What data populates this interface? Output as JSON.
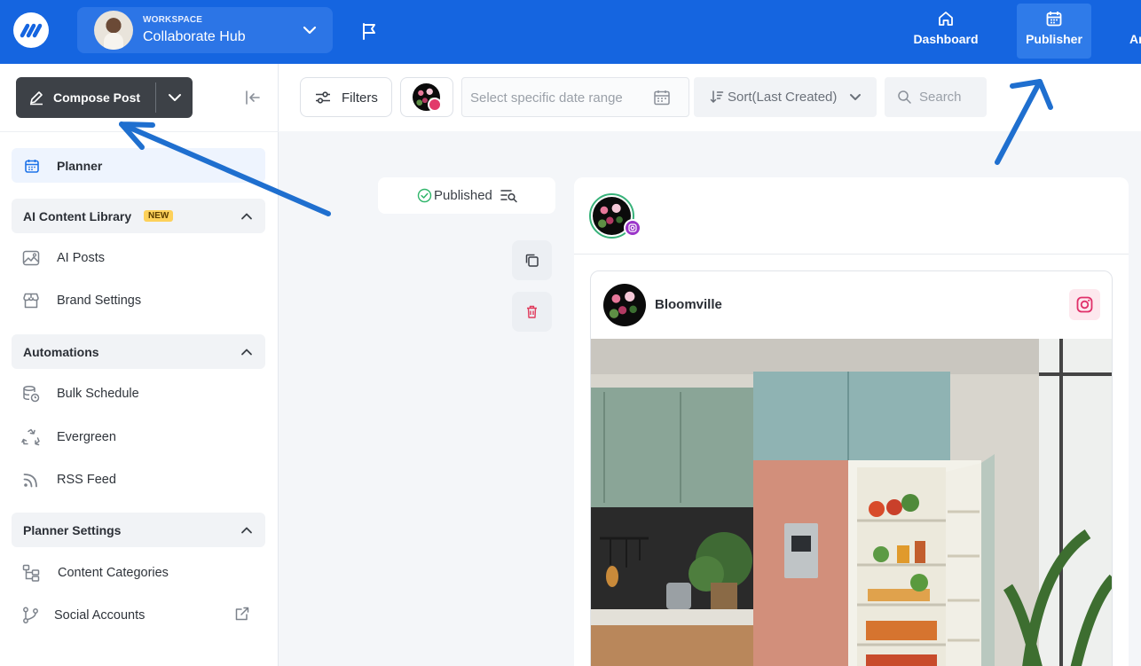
{
  "header": {
    "workspace_label": "WORKSPACE",
    "workspace_name": "Collaborate Hub",
    "nav": [
      {
        "label": "Dashboard",
        "icon": "home-icon"
      },
      {
        "label": "Publisher",
        "icon": "calendar-icon",
        "active": true
      },
      {
        "label": "An",
        "icon": ""
      }
    ],
    "brand_color": "#1565e0"
  },
  "sidebar": {
    "compose_label": "Compose Post",
    "planner_label": "Planner",
    "sections": [
      {
        "title": "AI Content Library",
        "badge": "NEW",
        "items": [
          "AI Posts",
          "Brand Settings"
        ]
      },
      {
        "title": "Automations",
        "items": [
          "Bulk Schedule",
          "Evergreen",
          "RSS Feed"
        ]
      },
      {
        "title": "Planner Settings",
        "items": [
          "Content Categories",
          "Social Accounts"
        ]
      }
    ]
  },
  "toolbar": {
    "filters_label": "Filters",
    "date_placeholder": "Select specific date range",
    "sort_label": "Sort(Last Created)",
    "search_placeholder": "Search"
  },
  "post": {
    "status": "Published",
    "account_name": "Bloomville",
    "platform": "instagram"
  },
  "annotations": {
    "arrow_color": "#1f6fcf"
  }
}
